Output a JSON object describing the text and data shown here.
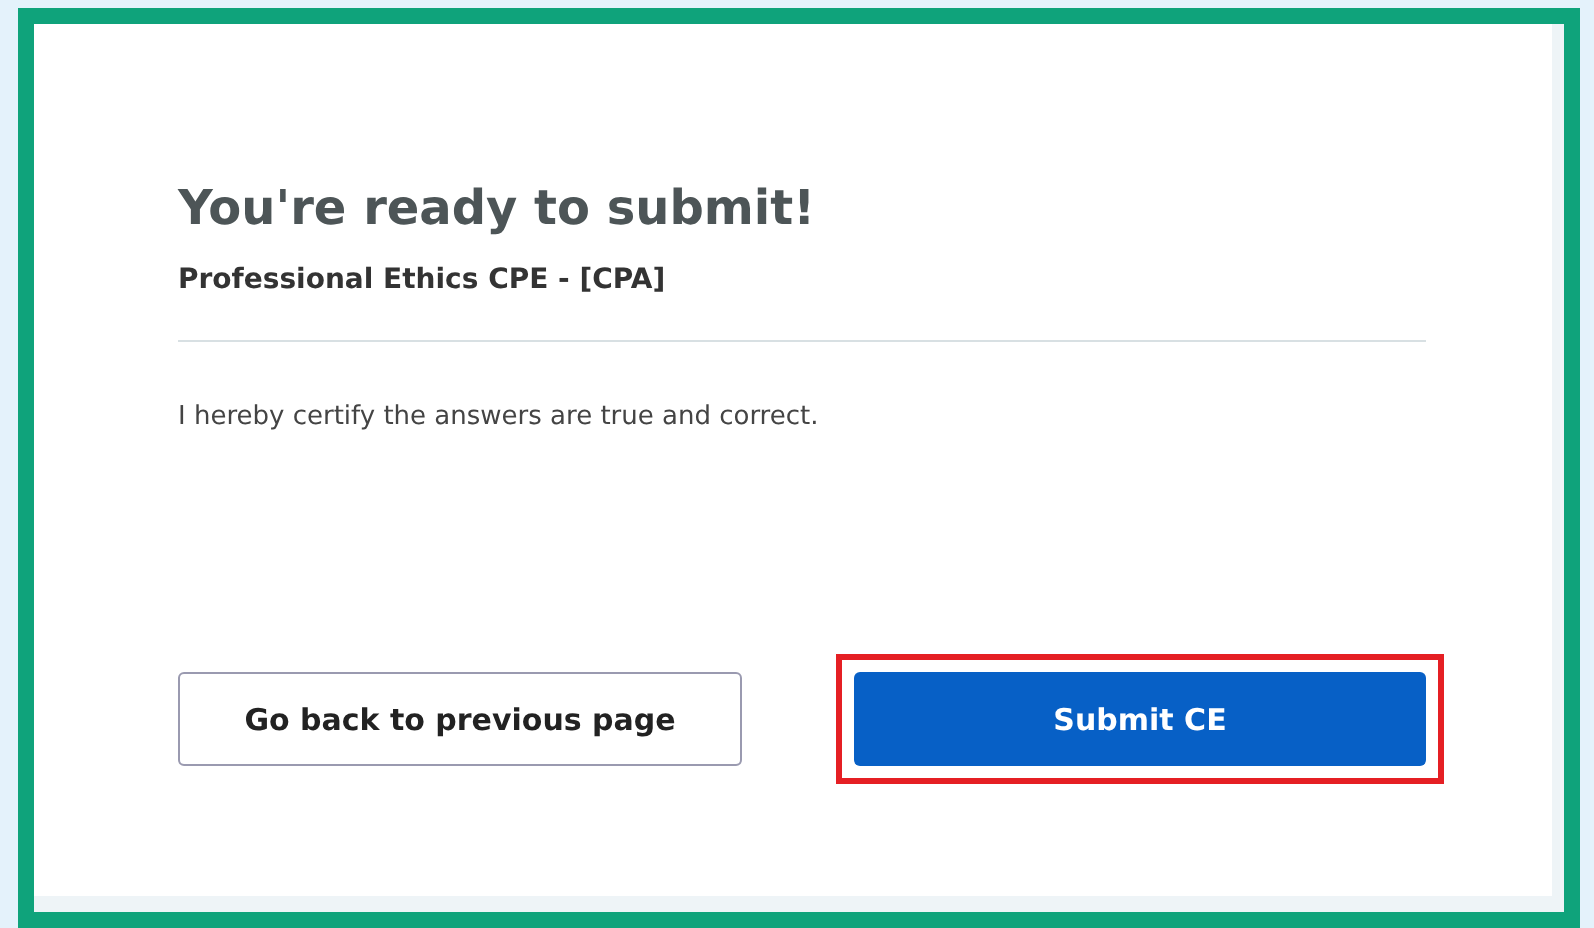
{
  "title": "You're ready to submit!",
  "course": "Professional Ethics CPE - [CPA]",
  "certification": "I hereby certify the answers are true and correct.",
  "buttons": [
    {
      "label": "Go back to previous page",
      "kind": "secondary",
      "highlighted": false
    },
    {
      "label": "Submit CE",
      "kind": "primary",
      "highlighted": true
    }
  ]
}
